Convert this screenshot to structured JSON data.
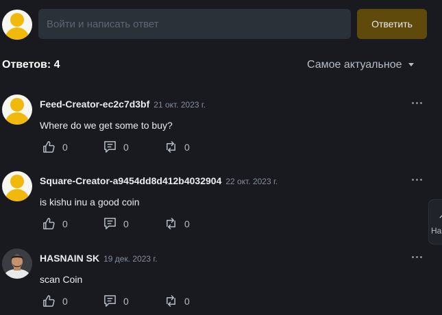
{
  "composer": {
    "placeholder": "Войти и написать ответ",
    "reply_button": "Ответить"
  },
  "header": {
    "answers_count": "Ответов: 4",
    "sort_label": "Самое актуальное"
  },
  "comments": [
    {
      "author": "Feed-Creator-ec2c7d3bf",
      "date": "21 окт. 2023 г.",
      "text": "Where do we get some to buy?",
      "likes": "0",
      "replies": "0",
      "reposts": "0",
      "avatar": "default-avatar"
    },
    {
      "author": "Square-Creator-a9454dd8d412b4032904",
      "date": "22 окт. 2023 г.",
      "text": "is kishu inu a good coin",
      "likes": "0",
      "replies": "0",
      "reposts": "0",
      "avatar": "default-avatar"
    },
    {
      "author": "HASNAIN SK",
      "date": "19 дек. 2023 г.",
      "text": "scan Coin",
      "likes": "0",
      "replies": "0",
      "reposts": "0",
      "avatar": "photo-avatar"
    }
  ],
  "edge_widget": {
    "label": "На"
  },
  "colors": {
    "background": "#181a20",
    "input_bg": "#2b3139",
    "accent_button": "#5f4a0b",
    "brand_yellow": "#f0b90b",
    "muted_text": "#848e9c"
  },
  "icons": [
    "thumbs-up-icon",
    "comment-icon",
    "repost-icon",
    "more-dots-icon",
    "caret-down-icon",
    "arrow-up-icon"
  ]
}
